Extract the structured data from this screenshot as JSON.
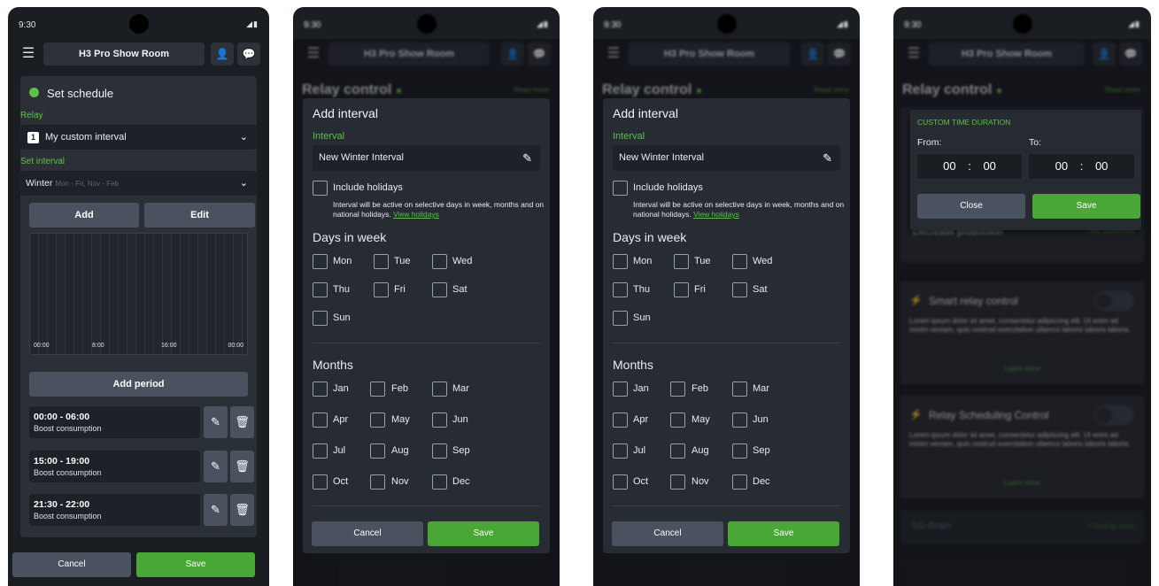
{
  "status": {
    "time": "9:30"
  },
  "header": {
    "title": "H3 Pro Show Room"
  },
  "screen1": {
    "card_title": "Set schedule",
    "relay_label": "Relay",
    "relay_badge": "1",
    "relay_value": "My custom interval",
    "interval_label": "Set interval",
    "interval_name": "Winter",
    "interval_detail": "Mon - Fri, Nov - Feb",
    "add_label": "Add",
    "edit_label": "Edit",
    "timeline_ticks": [
      "00:00",
      "8:00",
      "16:00",
      "00:00"
    ],
    "add_period_label": "Add period",
    "periods": [
      {
        "time": "00:00 - 06:00",
        "mode": "Boost consumption"
      },
      {
        "time": "15:00 - 19:00",
        "mode": "Boost consumption"
      },
      {
        "time": "21:30 - 22:00",
        "mode": "Boost consumption"
      }
    ],
    "cancel_label": "Cancel",
    "save_label": "Save"
  },
  "relay_page": {
    "title": "Relay control",
    "read_more": "Read more"
  },
  "interval_modal": {
    "title": "Add interval",
    "interval_label": "Interval",
    "interval_value": "New Winter Interval",
    "include_holidays": "Include holidays",
    "holidays_note": "Interval will be active on selective days in week, months and on national holidays.",
    "view_holidays": "View holidays",
    "days_title": "Days in week",
    "days": [
      "Mon",
      "Tue",
      "Wed",
      "Thu",
      "Fri",
      "Sat",
      "Sun"
    ],
    "months_title": "Months",
    "months": [
      "Jan",
      "Feb",
      "Mar",
      "Apr",
      "May",
      "Jun",
      "Jul",
      "Aug",
      "Sep",
      "Oct",
      "Nov",
      "Dec"
    ],
    "cancel_label": "Cancel",
    "save_label": "Save"
  },
  "screen4": {
    "duration_title": "CUSTOM TIME DURATION",
    "from_label": "From:",
    "to_label": "To:",
    "from_h": "00",
    "from_m": "00",
    "to_h": "00",
    "to_m": "00",
    "sep": ":",
    "close_label": "Close",
    "save_label": "Save",
    "bg_item1": "Decrease production",
    "bg_item1_right": "No override",
    "smart_title": "Smart relay control",
    "smart_text": "Lorem ipsum dolor sit amet, consectetur adipiscing elit. Ut enim ad minim veniam, quis nostrud exercitation ullamco laboris laboris laboris.",
    "learn_more": "Learn more",
    "sched_title": "Relay Scheduling Control",
    "sched_text": "Lorem ipsum dolor sit amet, consectetur adipiscing elit. Ut enim ad minim veniam, quis nostrud exercitation ullamco laboris laboris laboris.",
    "brain_title": "SG-Brain",
    "coming_soon": "Coming soon"
  },
  "colors": {
    "accent_green": "#49a835",
    "label_green": "#5ec14b",
    "panel": "#2b2f36",
    "background": "#1a1d22"
  }
}
